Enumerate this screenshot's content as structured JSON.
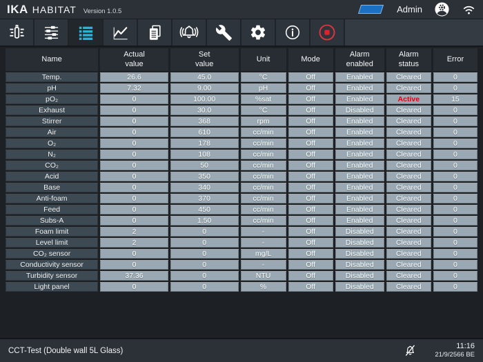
{
  "header": {
    "brand": "IKA",
    "product": "HABITAT",
    "version": "Version 1.0.5",
    "user": "Admin",
    "icons": [
      "blue-status-indicator",
      "user-avatar-icon",
      "wifi-icon"
    ]
  },
  "toolbar": {
    "selected": "table-view",
    "items": [
      {
        "id": "reactor-setup",
        "icon": "reactor-icon"
      },
      {
        "id": "process-settings",
        "icon": "sliders-icon"
      },
      {
        "id": "table-view",
        "icon": "list-icon"
      },
      {
        "id": "trend-chart",
        "icon": "chart-icon"
      },
      {
        "id": "reports",
        "icon": "documents-icon"
      },
      {
        "id": "alarms",
        "icon": "alarm-bell-icon"
      },
      {
        "id": "service",
        "icon": "wrench-icon"
      },
      {
        "id": "settings",
        "icon": "gear-icon"
      },
      {
        "id": "info",
        "icon": "info-icon"
      },
      {
        "id": "record",
        "icon": "record-icon"
      }
    ]
  },
  "table": {
    "columns": [
      "Name",
      "Actual\nvalue",
      "Set\nvalue",
      "Unit",
      "Mode",
      "Alarm\nenabled",
      "Alarm\nstatus",
      "Error"
    ],
    "rows": [
      {
        "name": "Temp.",
        "actual": "26.6",
        "set": "45.0",
        "unit": "°C",
        "mode": "Off",
        "alarm_enabled": "Enabled",
        "alarm_status": "Cleared",
        "error": "0"
      },
      {
        "name": "pH",
        "actual": "7.32",
        "set": "9.00",
        "unit": "pH",
        "mode": "Off",
        "alarm_enabled": "Enabled",
        "alarm_status": "Cleared",
        "error": "0"
      },
      {
        "name": "pO₂",
        "actual": "0",
        "set": "100.00",
        "unit": "%sat",
        "mode": "Off",
        "alarm_enabled": "Enabled",
        "alarm_status": "Active",
        "error": "15",
        "alarm_active": true
      },
      {
        "name": "Exhaust",
        "actual": "0",
        "set": "30.0",
        "unit": "°C",
        "mode": "Off",
        "alarm_enabled": "Disabled",
        "alarm_status": "Cleared",
        "error": "0"
      },
      {
        "name": "Stirrer",
        "actual": "0",
        "set": "368",
        "unit": "rpm",
        "mode": "Off",
        "alarm_enabled": "Enabled",
        "alarm_status": "Cleared",
        "error": "0"
      },
      {
        "name": "Air",
        "actual": "0",
        "set": "610",
        "unit": "cc/min",
        "mode": "Off",
        "alarm_enabled": "Enabled",
        "alarm_status": "Cleared",
        "error": "0"
      },
      {
        "name": "O₂",
        "actual": "0",
        "set": "178",
        "unit": "cc/min",
        "mode": "Off",
        "alarm_enabled": "Enabled",
        "alarm_status": "Cleared",
        "error": "0"
      },
      {
        "name": "N₂",
        "actual": "0",
        "set": "108",
        "unit": "cc/min",
        "mode": "Off",
        "alarm_enabled": "Enabled",
        "alarm_status": "Cleared",
        "error": "0"
      },
      {
        "name": "CO₂",
        "actual": "0",
        "set": "50",
        "unit": "cc/min",
        "mode": "Off",
        "alarm_enabled": "Enabled",
        "alarm_status": "Cleared",
        "error": "0"
      },
      {
        "name": "Acid",
        "actual": "0",
        "set": "350",
        "unit": "cc/min",
        "mode": "Off",
        "alarm_enabled": "Enabled",
        "alarm_status": "Cleared",
        "error": "0"
      },
      {
        "name": "Base",
        "actual": "0",
        "set": "340",
        "unit": "cc/min",
        "mode": "Off",
        "alarm_enabled": "Enabled",
        "alarm_status": "Cleared",
        "error": "0"
      },
      {
        "name": "Anti-foam",
        "actual": "0",
        "set": "370",
        "unit": "cc/min",
        "mode": "Off",
        "alarm_enabled": "Enabled",
        "alarm_status": "Cleared",
        "error": "0"
      },
      {
        "name": "Feed",
        "actual": "0",
        "set": "450",
        "unit": "cc/min",
        "mode": "Off",
        "alarm_enabled": "Enabled",
        "alarm_status": "Cleared",
        "error": "0"
      },
      {
        "name": "Subs-A",
        "actual": "0",
        "set": "1.50",
        "unit": "cc/min",
        "mode": "Off",
        "alarm_enabled": "Enabled",
        "alarm_status": "Cleared",
        "error": "0"
      },
      {
        "name": "Foam limit",
        "actual": "2",
        "set": "0",
        "unit": "-",
        "mode": "Off",
        "alarm_enabled": "Disabled",
        "alarm_status": "Cleared",
        "error": "0"
      },
      {
        "name": "Level limit",
        "actual": "2",
        "set": "0",
        "unit": "-",
        "mode": "Off",
        "alarm_enabled": "Disabled",
        "alarm_status": "Cleared",
        "error": "0"
      },
      {
        "name": "CO₂ sensor",
        "actual": "0",
        "set": "0",
        "unit": "mg/L",
        "mode": "Off",
        "alarm_enabled": "Disabled",
        "alarm_status": "Cleared",
        "error": "0"
      },
      {
        "name": "Conductivity sensor",
        "actual": "0",
        "set": "0",
        "unit": "-",
        "mode": "Off",
        "alarm_enabled": "Disabled",
        "alarm_status": "Cleared",
        "error": "0"
      },
      {
        "name": "Turbidity sensor",
        "actual": "37.36",
        "set": "0",
        "unit": "NTU",
        "mode": "Off",
        "alarm_enabled": "Disabled",
        "alarm_status": "Cleared",
        "error": "0"
      },
      {
        "name": "Light panel",
        "actual": "0",
        "set": "0",
        "unit": "%",
        "mode": "Off",
        "alarm_enabled": "Disabled",
        "alarm_status": "Cleared",
        "error": "0"
      }
    ]
  },
  "footer": {
    "vessel": "CCT-Test (Double wall 5L Glass)",
    "mute_icon": "bell-muted-icon",
    "time": "11:16",
    "date": "21/9/2566 BE"
  },
  "colors": {
    "accent_blue": "#1a70c2",
    "list_accent": "#29b4d6",
    "alarm_active": "#e8000d",
    "record_red": "#e5333f",
    "value_cell_bg": "#99a8b2",
    "name_cell_bg": "#3e4a53"
  }
}
